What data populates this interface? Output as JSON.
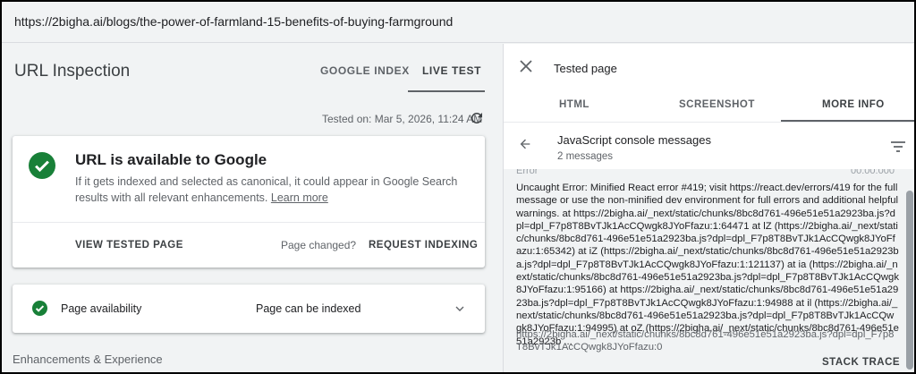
{
  "url_bar": {
    "url": "https://2bigha.ai/blogs/the-power-of-farmland-15-benefits-of-buying-farmground"
  },
  "left": {
    "title": "URL Inspection",
    "tabs": [
      {
        "label": "GOOGLE INDEX"
      },
      {
        "label": "LIVE TEST"
      }
    ],
    "tested_on": "Tested on: Mar 5, 2026, 11:24 AM",
    "main_card": {
      "title": "URL is available to Google",
      "description": "If it gets indexed and selected as canonical, it could appear in Google Search results with all relevant enhancements.",
      "learn_more": "Learn more",
      "view_tested_page": "VIEW TESTED PAGE",
      "page_changed": "Page changed?",
      "request_indexing": "REQUEST INDEXING"
    },
    "availability": {
      "label": "Page availability",
      "value": "Page can be indexed"
    },
    "enhancements": "Enhancements & Experience"
  },
  "right": {
    "title": "Tested page",
    "tabs": [
      {
        "label": "HTML"
      },
      {
        "label": "SCREENSHOT"
      },
      {
        "label": "MORE INFO"
      }
    ],
    "section": {
      "title": "JavaScript console messages",
      "subtitle": "2 messages"
    },
    "message": {
      "cut_label": "Error",
      "cut_time": "00:00:000",
      "text": "Uncaught Error: Minified React error #419; visit https://react.dev/errors/419 for the full message or use the non-minified dev environment for full errors and additional helpful warnings. at https://2bigha.ai/_next/static/chunks/8bc8d761-496e51e51a2923ba.js?dpl=dpl_F7p8T8BvTJk1AcCQwgk8JYoFfazu:1:64471 at lZ (https://2bigha.ai/_next/static/chunks/8bc8d761-496e51e51a2923ba.js?dpl=dpl_F7p8T8BvTJk1AcCQwgk8JYoFfazu:1:65342) at iZ (https://2bigha.ai/_next/static/chunks/8bc8d761-496e51e51a2923ba.js?dpl=dpl_F7p8T8BvTJk1AcCQwgk8JYoFfazu:1:121137) at ia (https://2bigha.ai/_next/static/chunks/8bc8d761-496e51e51a2923ba.js?dpl=dpl_F7p8T8BvTJk1AcCQwgk8JYoFfazu:1:95166) at https://2bigha.ai/_next/static/chunks/8bc8d761-496e51e51a2923ba.js?dpl=dpl_F7p8T8BvTJk1AcCQwgk8JYoFfazu:1:94988 at il (https://2bigha.ai/_next/static/chunks/8bc8d761-496e51e51a2923ba.js?dpl=dpl_F7p8T8BvTJk1AcCQwgk8JYoFfazu:1:94995) at oZ (https://2bigha.ai/_next/static/chunks/8bc8d761-496e51e51a2923b ...",
      "source": "https://2bigha.ai/_next/static/chunks/8bc8d761-496e51e51a2923ba.js?dpl=dpl_F7p8T8BvTJk1AcCQwgk8JYoFfazu:0",
      "stack_trace": "STACK TRACE"
    }
  },
  "colors": {
    "success_green": "#188038",
    "panel_bg": "#f1f3f4",
    "card_bg": "#ffffff"
  },
  "icons": [
    "refresh-icon",
    "check-circle-icon",
    "chevron-down-icon",
    "close-icon",
    "back-arrow-icon",
    "filter-icon"
  ]
}
